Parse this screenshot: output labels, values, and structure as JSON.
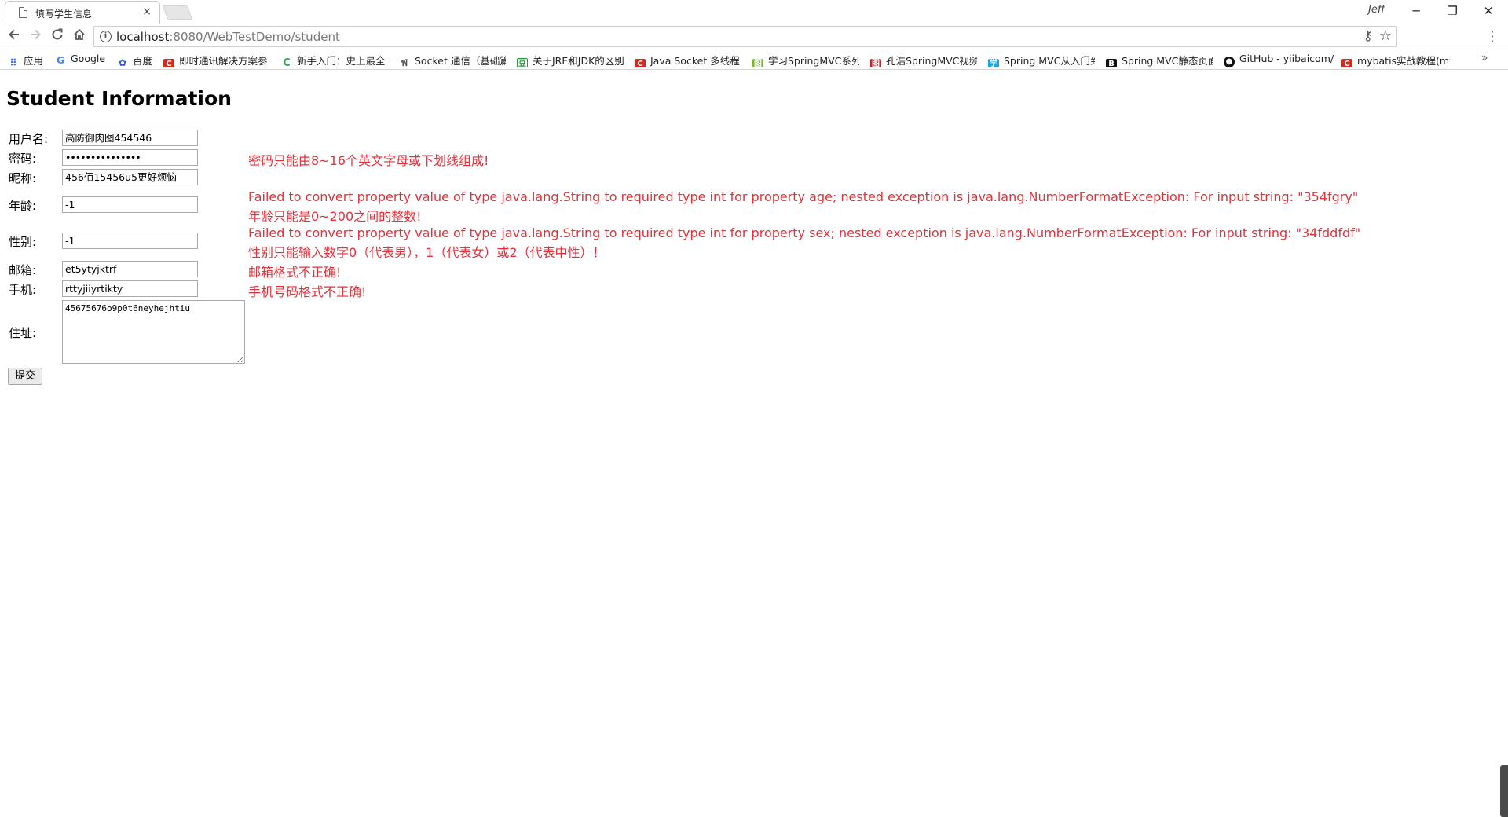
{
  "browser": {
    "tab_title": "填写学生信息",
    "tab_close": "×",
    "window_user": "Jeff",
    "win_minimize": "─",
    "win_restore": "❐",
    "win_close": "✕",
    "url_host": "localhost",
    "url_rest": ":8080/WebTestDemo/student",
    "bookmarks": [
      {
        "label": "应用",
        "icon": "apps-grid-icon",
        "color": "#3b78e7"
      },
      {
        "label": "Google",
        "icon": "google-icon",
        "color": "#4285f4"
      },
      {
        "label": "百度",
        "icon": "baidu-paw-icon",
        "color": "#2f5bd8"
      },
      {
        "label": "即时通讯解决方案参",
        "icon": "csdn-icon",
        "color": "#d52b1e"
      },
      {
        "label": "新手入门：史上最全",
        "icon": "green-circle-icon",
        "color": "#2bab4c"
      },
      {
        "label": "Socket 通信（基础篇",
        "icon": "socket-icon",
        "color": "#555555"
      },
      {
        "label": "关于JRE和JDK的区别",
        "icon": "douban-icon",
        "color": "#2e963d"
      },
      {
        "label": "Java Socket 多线程",
        "icon": "csdn-icon",
        "color": "#d52b1e"
      },
      {
        "label": "学习SpringMVC系列",
        "icon": "spring-icon",
        "color": "#77b829"
      },
      {
        "label": "孔浩SpringMVC视频",
        "icon": "red-book-icon",
        "color": "#c3272b"
      },
      {
        "label": "Spring MVC从入门到",
        "icon": "blue-icon",
        "color": "#1fa3e5"
      },
      {
        "label": "Spring MVC静态页面",
        "icon": "b-icon",
        "color": "#111111"
      },
      {
        "label": "GitHub - yiibaicom/",
        "icon": "github-icon",
        "color": "#111111"
      },
      {
        "label": "mybatis实战教程(my",
        "icon": "csdn-icon",
        "color": "#d52b1e"
      }
    ],
    "bookmarks_more": "»"
  },
  "page": {
    "title": "Student Information",
    "labels": {
      "username": "用户名:",
      "password": "密码:",
      "nickname": "昵称:",
      "age": "年龄:",
      "sex": "性别:",
      "email": "邮箱:",
      "phone": "手机:",
      "address": "住址:"
    },
    "values": {
      "username": "高防御肉图454546",
      "password": "•••••••••••••••",
      "nickname": "456佰15456u5更好烦恼",
      "age": "-1",
      "sex": "-1",
      "email": "et5ytyjktrf",
      "phone": "rttyjiiyrtikty",
      "address": "45675676o9p0t6neyhejhtiu"
    },
    "errors": {
      "password": "密码只能由8~16个英文字母或下划线组成!",
      "age_convert": "Failed to convert property value of type java.lang.String to required type int for property age; nested exception is java.lang.NumberFormatException: For input string: \"354fgry\"",
      "age_range": "年龄只能是0~200之间的整数!",
      "sex_convert": "Failed to convert property value of type java.lang.String to required type int for property sex; nested exception is java.lang.NumberFormatException: For input string: \"34fddfdf\"",
      "sex_range": "性别只能输入数字0（代表男），1（代表女）或2（代表中性）！",
      "email": "邮箱格式不正确!",
      "phone": "手机号码格式不正确!"
    },
    "submit_label": "提交",
    "error_color": "#e5303a"
  }
}
